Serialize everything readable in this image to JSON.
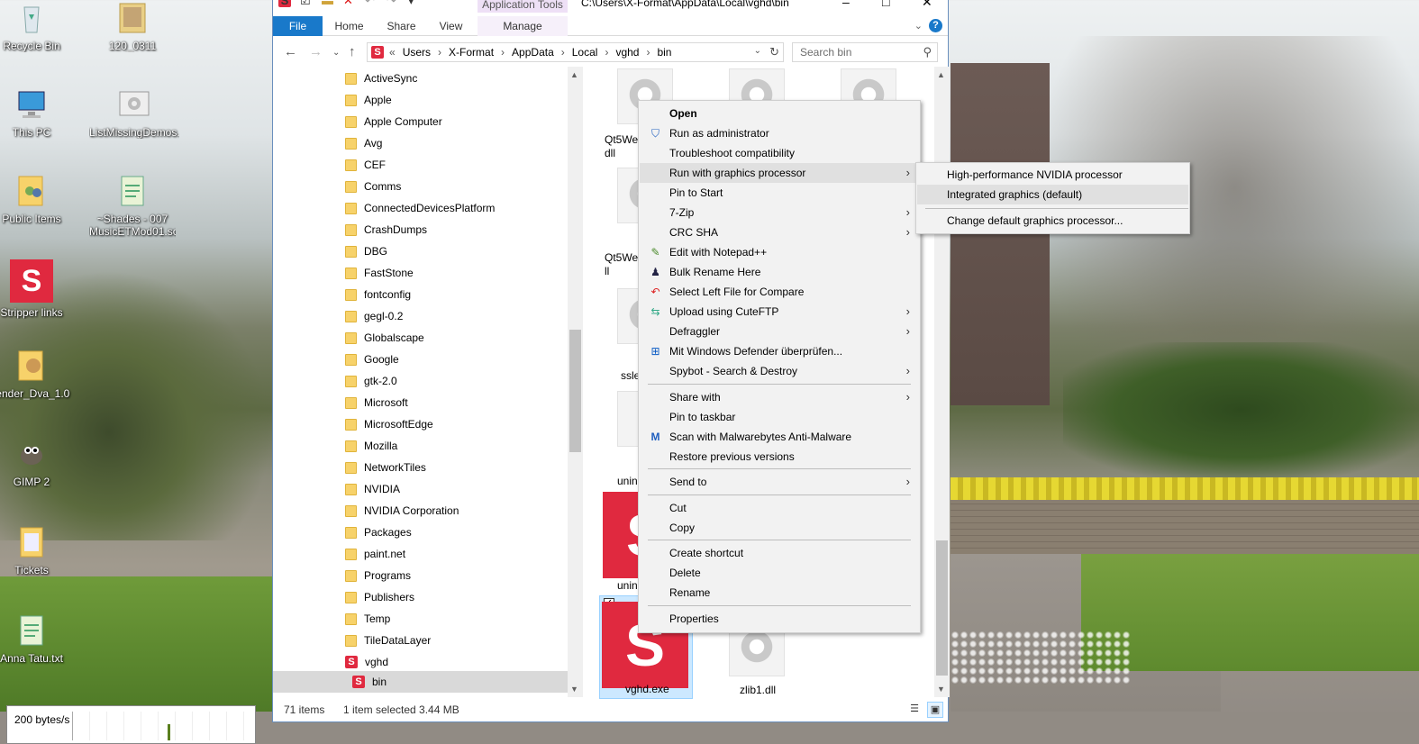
{
  "desktop": {
    "icons": [
      {
        "label": "Recycle Bin"
      },
      {
        "label": "120_0311"
      },
      {
        "label": "This PC"
      },
      {
        "label": "ListMissingDemos..."
      },
      {
        "label": "Public Items"
      },
      {
        "label": "~Shades - 007"
      },
      {
        "label": "MusicETMod01.scn"
      },
      {
        "label": "Stripper links"
      },
      {
        "label": "lender_Dva_1.0"
      },
      {
        "label": "GIMP 2"
      },
      {
        "label": "Tickets"
      },
      {
        "label": "Anna Tatu.txt"
      }
    ],
    "netmeter": {
      "rate": "200 bytes/s"
    }
  },
  "explorer": {
    "titlebar": {
      "path": "C:\\Users\\X-Format\\AppData\\Local\\vghd\\bin",
      "context_tab": "Application Tools"
    },
    "ribbon": {
      "tabs": [
        "File",
        "Home",
        "Share",
        "View",
        "Manage"
      ]
    },
    "address": {
      "prefix": "«",
      "crumbs": [
        "Users",
        "X-Format",
        "AppData",
        "Local",
        "vghd",
        "bin"
      ]
    },
    "search": {
      "placeholder": "Search bin"
    },
    "nav": {
      "folders": [
        "ActiveSync",
        "Apple",
        "Apple Computer",
        "Avg",
        "CEF",
        "Comms",
        "ConnectedDevicesPlatform",
        "CrashDumps",
        "DBG",
        "FastStone",
        "fontconfig",
        "gegl-0.2",
        "Globalscape",
        "Google",
        "gtk-2.0",
        "Microsoft",
        "MicrosoftEdge",
        "Mozilla",
        "NetworkTiles",
        "NVIDIA",
        "NVIDIA Corporation",
        "Packages",
        "paint.net",
        "Programs",
        "Publishers",
        "Temp",
        "TileDataLayer"
      ],
      "app_folder": "vghd",
      "selected": "bin"
    },
    "files": {
      "partial_labels": [
        "Qt5We",
        "dll",
        "Qt5We",
        "ll",
        "sslea",
        "unin",
        "unin"
      ],
      "selected_file": "vghd.exe",
      "other_file": "zlib1.dll"
    },
    "status": {
      "count": "71 items",
      "selection": "1 item selected  3.44 MB"
    }
  },
  "context_menu": {
    "items": [
      {
        "label": "Open",
        "bold": true
      },
      {
        "label": "Run as administrator",
        "icon": "shield-icon"
      },
      {
        "label": "Troubleshoot compatibility"
      },
      {
        "label": "Run with graphics processor",
        "submenu": true,
        "highlighted": true
      },
      {
        "label": "Pin to Start"
      },
      {
        "label": "7-Zip",
        "submenu": true
      },
      {
        "label": "CRC SHA",
        "submenu": true
      },
      {
        "label": "Edit with Notepad++",
        "icon": "notepad-icon"
      },
      {
        "label": "Bulk Rename Here",
        "icon": "bulk-rename-icon"
      },
      {
        "label": "Select Left File for Compare",
        "icon": "compare-icon"
      },
      {
        "label": "Upload using CuteFTP",
        "submenu": true,
        "icon": "cuteftp-icon"
      },
      {
        "label": "Defraggler",
        "submenu": true
      },
      {
        "label": "Mit Windows Defender überprüfen...",
        "icon": "defender-icon"
      },
      {
        "label": "Spybot - Search & Destroy",
        "submenu": true
      },
      {
        "label": "Share with",
        "submenu": true
      },
      {
        "label": "Pin to taskbar"
      },
      {
        "label": "Scan with Malwarebytes Anti-Malware",
        "icon": "malwarebytes-icon"
      },
      {
        "label": "Restore previous versions"
      },
      {
        "label": "Send to",
        "submenu": true
      },
      {
        "label": "Cut"
      },
      {
        "label": "Copy"
      },
      {
        "label": "Create shortcut"
      },
      {
        "label": "Delete"
      },
      {
        "label": "Rename"
      },
      {
        "label": "Properties"
      }
    ],
    "submenu": [
      {
        "label": "High-performance NVIDIA processor"
      },
      {
        "label": "Integrated graphics (default)",
        "highlighted": true
      },
      {
        "label": "Change default graphics processor..."
      }
    ]
  },
  "colors": {
    "accent": "#1979ca",
    "vghd_red": "#e0293f",
    "selection": "#cce8ff"
  }
}
